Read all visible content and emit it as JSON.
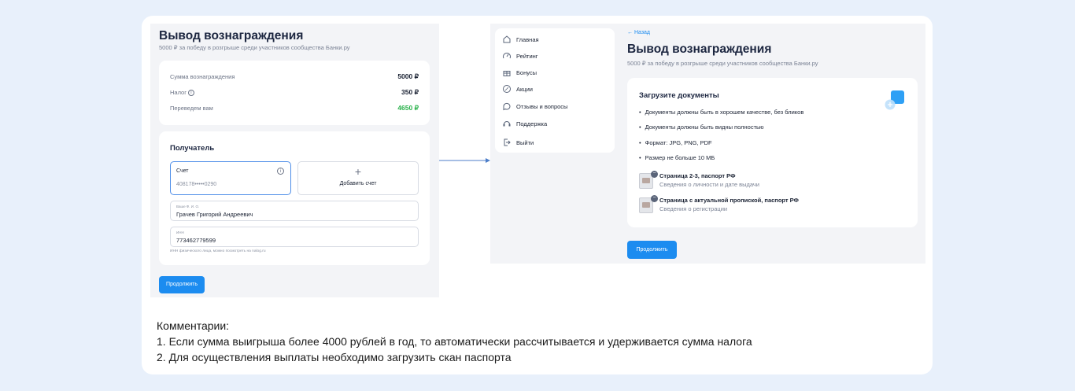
{
  "left": {
    "title": "Вывод вознаграждения",
    "subtitle": "5000 ₽ за победу в розгрыше среди участников сообщества Банки.ру",
    "summary": [
      {
        "label": "Сумма вознаграждения",
        "value": "5000 ₽"
      },
      {
        "label": "Налог",
        "value": "350 ₽"
      },
      {
        "label": "Переведем вам",
        "value": "4650 ₽"
      }
    ],
    "recipient_title": "Получатель",
    "account_label": "Счет",
    "account_number": "408178•••••0290",
    "add_account": "Добавить счет",
    "fio_label": "Ваше Ф. И. О.",
    "fio_value": "Грачев Григорий Андреевич",
    "inn_label": "ИНН",
    "inn_value": "773462779599",
    "inn_hint": "ИНН физического лица, можно посмотреть на nalog.ru",
    "continue": "Продолжить",
    "colors": {
      "accent": "#1c8cf0",
      "green": "#2bb24c"
    }
  },
  "right": {
    "nav": [
      {
        "label": "Главная",
        "icon": "home-icon"
      },
      {
        "label": "Рейтинг",
        "icon": "gauge-icon"
      },
      {
        "label": "Бонусы",
        "icon": "gift-icon"
      },
      {
        "label": "Акции",
        "icon": "percent-icon"
      },
      {
        "label": "Отзывы и вопросы",
        "icon": "chat-icon"
      },
      {
        "label": "Поддержка",
        "icon": "support-icon"
      },
      {
        "label": "Выйти",
        "icon": "logout-icon"
      }
    ],
    "back": "Назад",
    "title": "Вывод вознаграждения",
    "subtitle": "5000 ₽ за победу в розгрыше среди участников сообщества Банки.ру",
    "upload_title": "Загрузите документы",
    "requirements": [
      "Документы должны быть в хорошем качестве, без бликов",
      "Документы должны быть видны полностью",
      "Формат: JPG, PNG, PDF",
      "Размер не больше 10 МБ"
    ],
    "passports": [
      {
        "title": "Страница 2-3, паспорт РФ",
        "subtitle": "Сведения о личности и дате выдачи"
      },
      {
        "title": "Страница с актуальной пропиской, паспорт РФ",
        "subtitle": "Сведения о регистрации"
      }
    ],
    "continue": "Продолжить"
  },
  "comments": {
    "heading": "Комментарии:",
    "items": [
      "1. Если сумма выигрыша более 4000 рублей в год, то автоматически рассчитывается и удерживается сумма налога",
      "2. Для осуществления выплаты необходимо загрузить скан паспорта"
    ]
  }
}
